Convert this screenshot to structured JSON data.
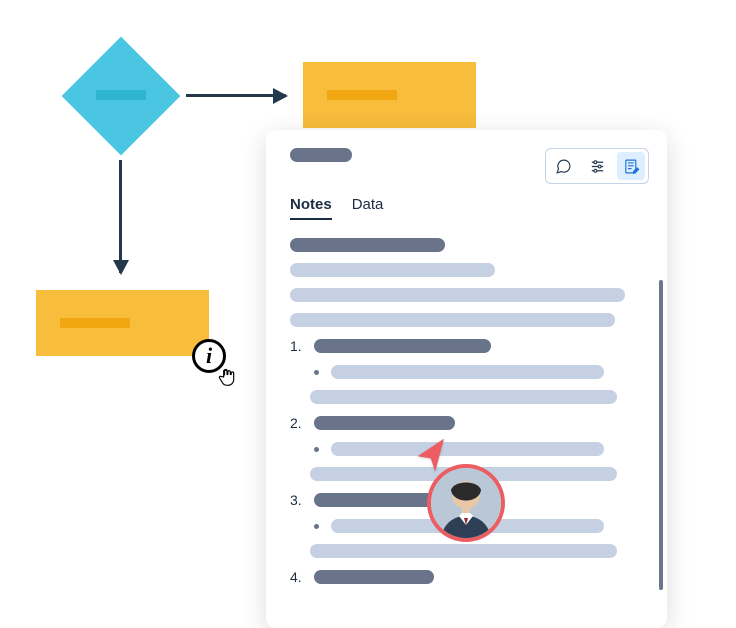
{
  "flowchart": {
    "decision": {
      "shape": "diamond",
      "color": "#4ac6e2"
    },
    "process_top": {
      "shape": "rectangle",
      "color": "#f8bd3c"
    },
    "process_bottom": {
      "shape": "rectangle",
      "color": "#f8bd3c"
    },
    "edges": [
      {
        "from": "decision",
        "to": "process_top",
        "direction": "right"
      },
      {
        "from": "decision",
        "to": "process_bottom",
        "direction": "down"
      }
    ]
  },
  "info_badge": {
    "glyph": "i"
  },
  "panel": {
    "tools": {
      "comment": "comment-icon",
      "filter": "filter-icon",
      "edit": "edit-note-icon",
      "active": "edit"
    },
    "tabs": {
      "items": [
        "Notes",
        "Data"
      ],
      "active": "Notes"
    },
    "list_markers": {
      "n1": "1.",
      "n2": "2.",
      "n3": "3.",
      "n4": "4."
    }
  },
  "collaborator": {
    "cursor_color": "#ec5d62",
    "avatar_ring_color": "#ec5d62"
  }
}
